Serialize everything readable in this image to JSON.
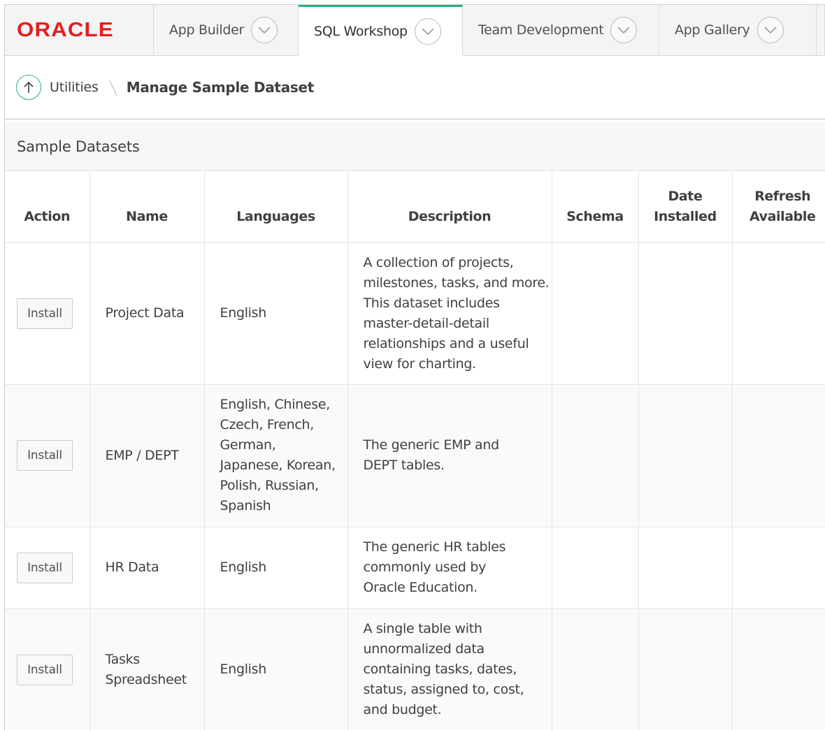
{
  "brand": {
    "logo_text": "ORACLE"
  },
  "nav": {
    "tabs": [
      {
        "label": "App Builder",
        "active": false
      },
      {
        "label": "SQL Workshop",
        "active": true
      },
      {
        "label": "Team Development",
        "active": false
      },
      {
        "label": "App Gallery",
        "active": false
      }
    ]
  },
  "breadcrumb": {
    "parent": "Utilities",
    "current": "Manage Sample Dataset"
  },
  "region": {
    "title": "Sample Datasets"
  },
  "table": {
    "headers": {
      "action": "Action",
      "name": "Name",
      "languages": "Languages",
      "description": "Description",
      "schema": "Schema",
      "date_installed": "Date Installed",
      "refresh_available": "Refresh Available"
    },
    "rows": [
      {
        "action": "Install",
        "name": "Project Data",
        "languages": "English",
        "description": "A collection of projects, milestones, tasks, and more. This dataset includes master-detail-detail relationships and a useful view for charting.",
        "schema": "",
        "date_installed": "",
        "refresh_available": ""
      },
      {
        "action": "Install",
        "name": "EMP / DEPT",
        "languages": "English, Chinese, Czech, French, German, Japanese, Korean, Polish, Russian, Spanish",
        "description": "The generic EMP and DEPT tables.",
        "schema": "",
        "date_installed": "",
        "refresh_available": ""
      },
      {
        "action": "Install",
        "name": "HR Data",
        "languages": "English",
        "description": "The generic HR tables commonly used by Oracle Education.",
        "schema": "",
        "date_installed": "",
        "refresh_available": ""
      },
      {
        "action": "Install",
        "name": "Tasks Spreadsheet",
        "languages": "English",
        "description": "A single table with unnormalized data containing tasks, dates, status, assigned to, cost, and budget.",
        "schema": "",
        "date_installed": "",
        "refresh_available": ""
      }
    ]
  },
  "colors": {
    "accent": "#25b37a",
    "brand": "#e01f1f"
  }
}
